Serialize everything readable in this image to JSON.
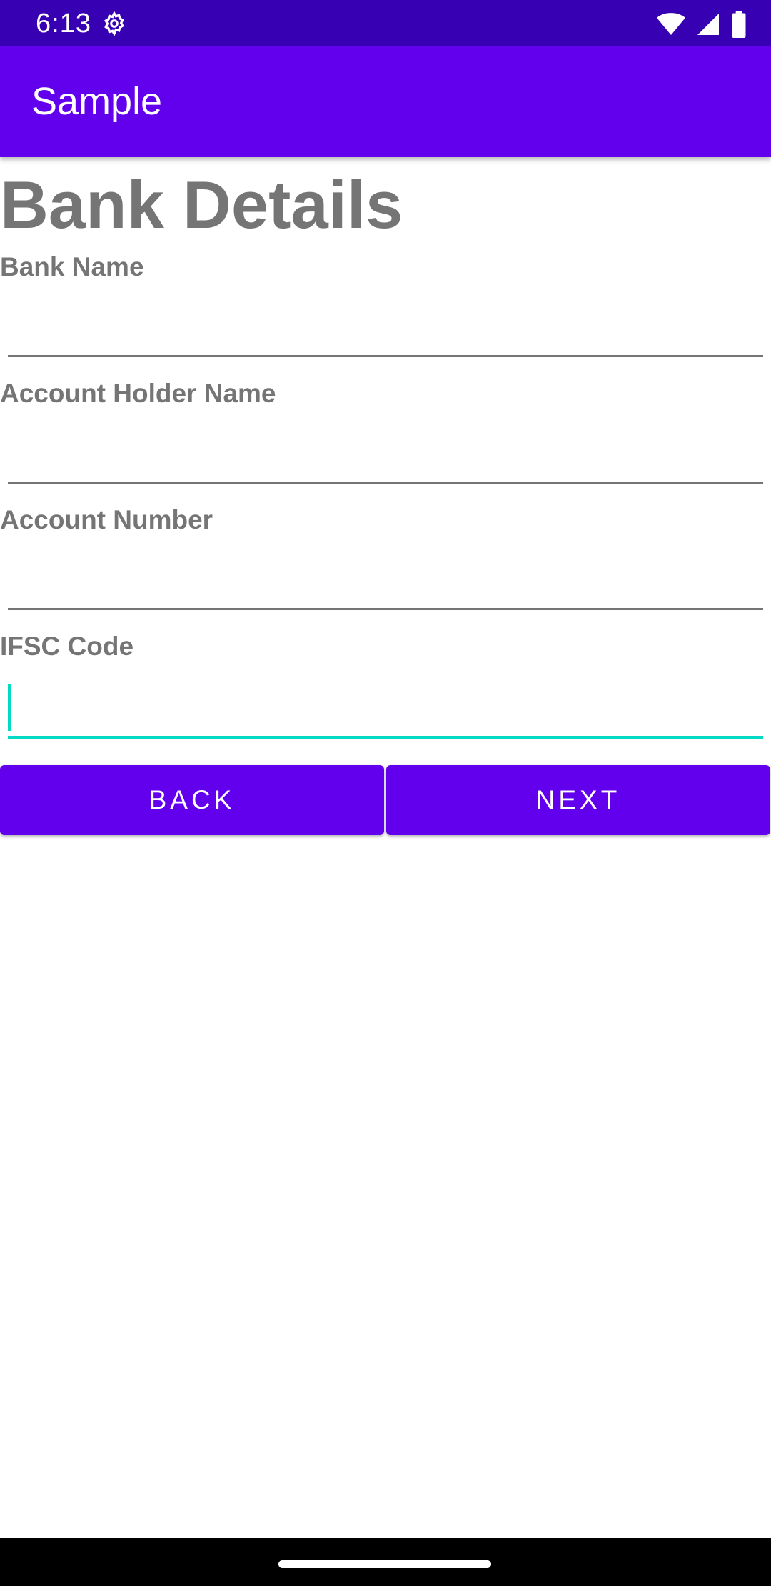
{
  "status_bar": {
    "time": "6:13",
    "icons": [
      "settings-gear-icon",
      "wifi-icon",
      "signal-icon",
      "battery-icon"
    ]
  },
  "app_bar": {
    "title": "Sample"
  },
  "form": {
    "title": "Bank Details",
    "fields": [
      {
        "label": "Bank Name",
        "value": "",
        "placeholder": ""
      },
      {
        "label": "Account Holder Name",
        "value": "",
        "placeholder": ""
      },
      {
        "label": "Account Number",
        "value": "",
        "placeholder": ""
      },
      {
        "label": "IFSC Code",
        "value": "",
        "placeholder": ""
      }
    ],
    "back_label": "BACK",
    "next_label": "NEXT"
  },
  "colors": {
    "status_bar": "#3700b3",
    "primary": "#6200ee",
    "accent": "#03dac5",
    "label_gray": "#757575"
  }
}
